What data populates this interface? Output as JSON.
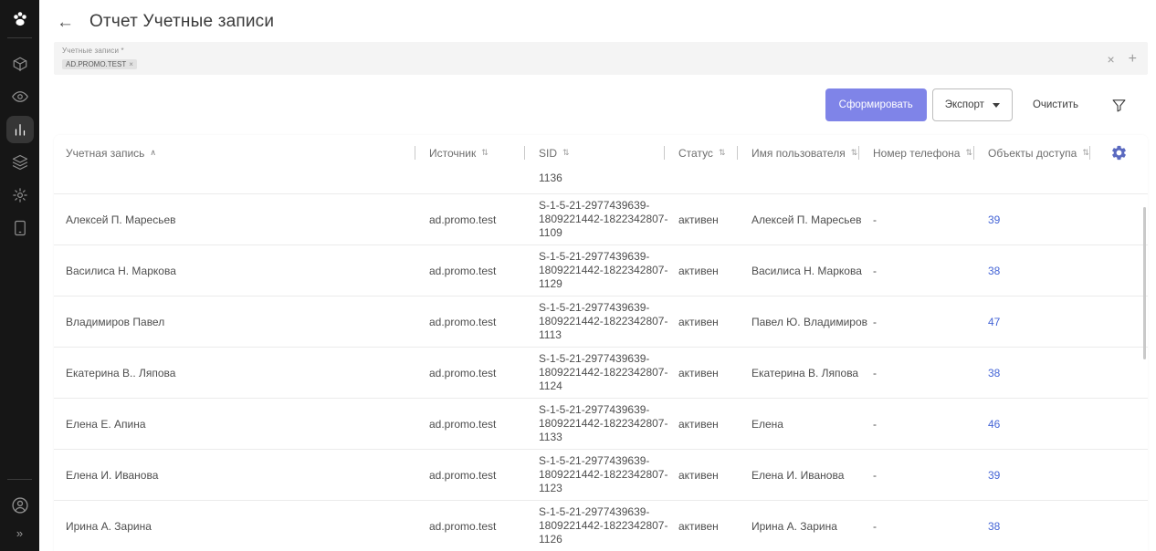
{
  "colors": {
    "accent": "#7f84e8",
    "link": "#4565d6",
    "sidebar_bg": "#161616",
    "header_gear": "#5b6ac0"
  },
  "sidebar": {
    "icons": [
      "paw-logo-icon",
      "cube-icon",
      "eye-icon",
      "bar-chart-icon",
      "layers-icon",
      "gear-icon",
      "tablet-icon",
      "user-circle-icon"
    ],
    "active_item": "bar-chart-icon",
    "expand_icon": "»"
  },
  "header": {
    "back_icon": "←",
    "title": "Отчет Учетные записи"
  },
  "filter": {
    "label": "Учетные записи *",
    "chip": "AD.PROMO.TEST",
    "chip_remove_icon": "×",
    "clear_icon": "×",
    "add_icon": "+"
  },
  "toolbar": {
    "generate_label": "Сформировать",
    "export_label": "Экспорт",
    "clear_label": "Очистить"
  },
  "table": {
    "columns": [
      {
        "label": "Учетная запись",
        "sort_glyph": "∧"
      },
      {
        "label": "Источник",
        "sort_glyph": "⇅"
      },
      {
        "label": "SID",
        "sort_glyph": "⇅"
      },
      {
        "label": "Статус",
        "sort_glyph": "⇅"
      },
      {
        "label": "Имя пользователя",
        "sort_glyph": "⇅"
      },
      {
        "label": "Номер телефона",
        "sort_glyph": "⇅"
      },
      {
        "label": "Объекты доступа",
        "sort_glyph": "⇅"
      }
    ],
    "partial_sid": "1136",
    "rows": [
      {
        "account": "Алексей П. Маресьев",
        "source": "ad.promo.test",
        "sid": [
          "S-1-5-21-2977439639-",
          "1809221442-1822342807-",
          "1109"
        ],
        "status": "активен",
        "user": "Алексей П. Маресьев",
        "phone": "-",
        "objects": "39"
      },
      {
        "account": "Василиса Н. Маркова",
        "source": "ad.promo.test",
        "sid": [
          "S-1-5-21-2977439639-",
          "1809221442-1822342807-",
          "1129"
        ],
        "status": "активен",
        "user": "Василиса Н. Маркова",
        "phone": "-",
        "objects": "38"
      },
      {
        "account": "Владимиров Павел",
        "source": "ad.promo.test",
        "sid": [
          "S-1-5-21-2977439639-",
          "1809221442-1822342807-",
          "1113"
        ],
        "status": "активен",
        "user": "Павел Ю. Владимиров",
        "phone": "-",
        "objects": "47"
      },
      {
        "account": "Екатерина В.. Ляпова",
        "source": "ad.promo.test",
        "sid": [
          "S-1-5-21-2977439639-",
          "1809221442-1822342807-",
          "1124"
        ],
        "status": "активен",
        "user": "Екатерина В. Ляпова",
        "phone": "-",
        "objects": "38"
      },
      {
        "account": "Елена Е. Апина",
        "source": "ad.promo.test",
        "sid": [
          "S-1-5-21-2977439639-",
          "1809221442-1822342807-",
          "1133"
        ],
        "status": "активен",
        "user": "Елена",
        "phone": "-",
        "objects": "46"
      },
      {
        "account": "Елена И. Иванова",
        "source": "ad.promo.test",
        "sid": [
          "S-1-5-21-2977439639-",
          "1809221442-1822342807-",
          "1123"
        ],
        "status": "активен",
        "user": "Елена И. Иванова",
        "phone": "-",
        "objects": "39"
      },
      {
        "account": "Ирина А. Зарина",
        "source": "ad.promo.test",
        "sid": [
          "S-1-5-21-2977439639-",
          "1809221442-1822342807-",
          "1126"
        ],
        "status": "активен",
        "user": "Ирина А. Зарина",
        "phone": "-",
        "objects": "38"
      }
    ]
  }
}
